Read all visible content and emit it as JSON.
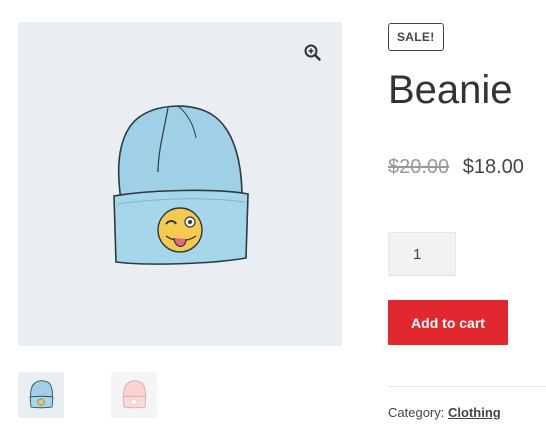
{
  "product": {
    "sale_badge": "SALE!",
    "title": "Beanie",
    "price_regular": "$20.00",
    "price_sale": "$18.00",
    "quantity": "1",
    "add_to_cart_label": "Add to cart",
    "category_label": "Category:",
    "category_link": "Clothing"
  },
  "gallery": {
    "zoom_icon": "magnifier-plus-icon",
    "main_image": "blue-beanie-with-emoji-patch",
    "thumbnails": [
      "blue-beanie-thumbnail",
      "pink-beanie-thumbnail"
    ]
  },
  "colors": {
    "accent": "#e2282f",
    "text": "#43454b",
    "image_background": "#e8eef2"
  }
}
